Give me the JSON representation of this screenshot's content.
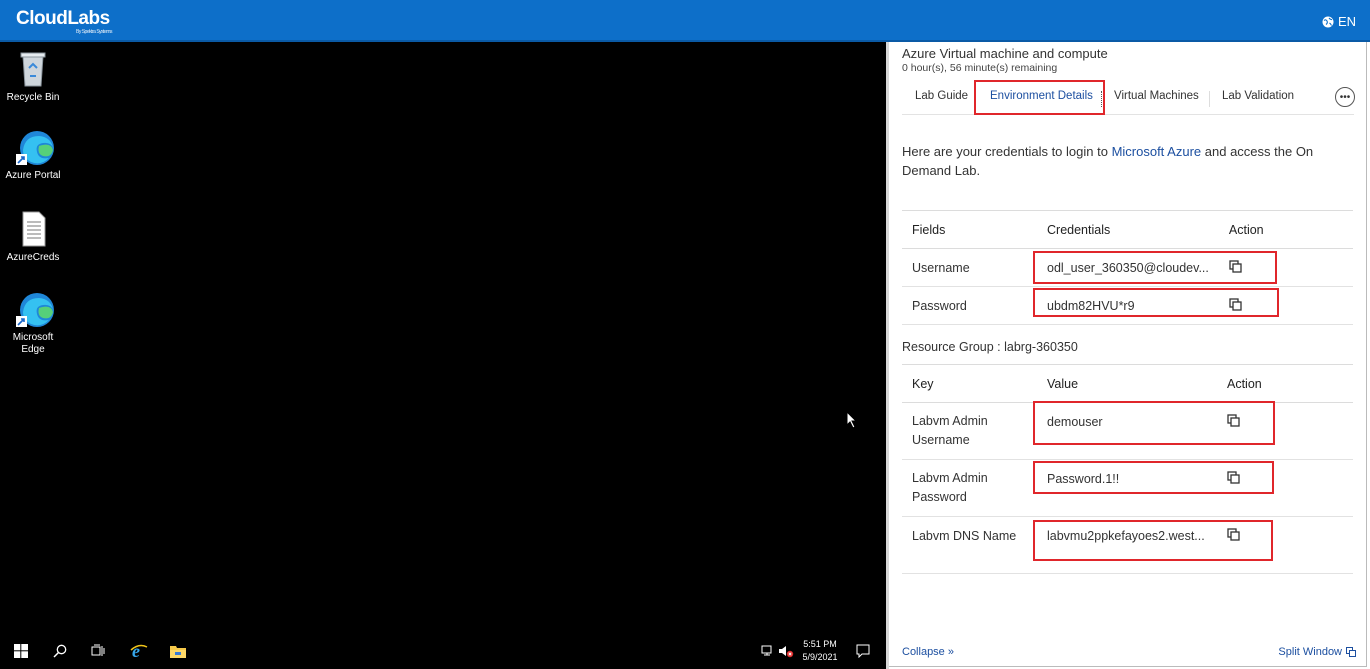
{
  "header": {
    "brand": "CloudLabs",
    "brand_sub": "By Spektra Systems",
    "language": "EN"
  },
  "desktop": {
    "icons": [
      {
        "label": "Recycle Bin"
      },
      {
        "label": "Azure Portal"
      },
      {
        "label": "AzureCreds"
      },
      {
        "label": "Microsoft Edge"
      }
    ]
  },
  "taskbar": {
    "time": "5:51 PM",
    "date": "5/9/2021"
  },
  "panel": {
    "title": "Azure Virtual machine and compute",
    "remaining": "0 hour(s), 56 minute(s) remaining",
    "tabs": [
      {
        "label": "Lab Guide"
      },
      {
        "label": "Environment Details"
      },
      {
        "label": "Virtual Machines"
      },
      {
        "label": "Lab Validation"
      }
    ],
    "intro_before": "Here are your credentials to login to ",
    "intro_link": "Microsoft Azure",
    "intro_after": " and access the On Demand Lab.",
    "cred_table": {
      "headers": [
        "Fields",
        "Credentials",
        "Action"
      ],
      "rows": [
        {
          "field": "Username",
          "value": "odl_user_360350@cloudev..."
        },
        {
          "field": "Password",
          "value": "ubdm82HVU*r9"
        }
      ]
    },
    "resource_group": "Resource Group : labrg-360350",
    "rg_table": {
      "headers": [
        "Key",
        "Value",
        "Action"
      ],
      "rows": [
        {
          "key": "Labvm Admin Username",
          "value": "demouser"
        },
        {
          "key": "Labvm Admin Password",
          "value": "Password.1!!"
        },
        {
          "key": "Labvm DNS Name",
          "value": "labvmu2ppkefayoes2.west..."
        }
      ]
    },
    "collapse": "Collapse »",
    "split_window": "Split Window"
  },
  "colors": {
    "brand_blue": "#0d6fc9",
    "highlight_red": "#e0262b",
    "link_blue": "#1c4fa0"
  }
}
